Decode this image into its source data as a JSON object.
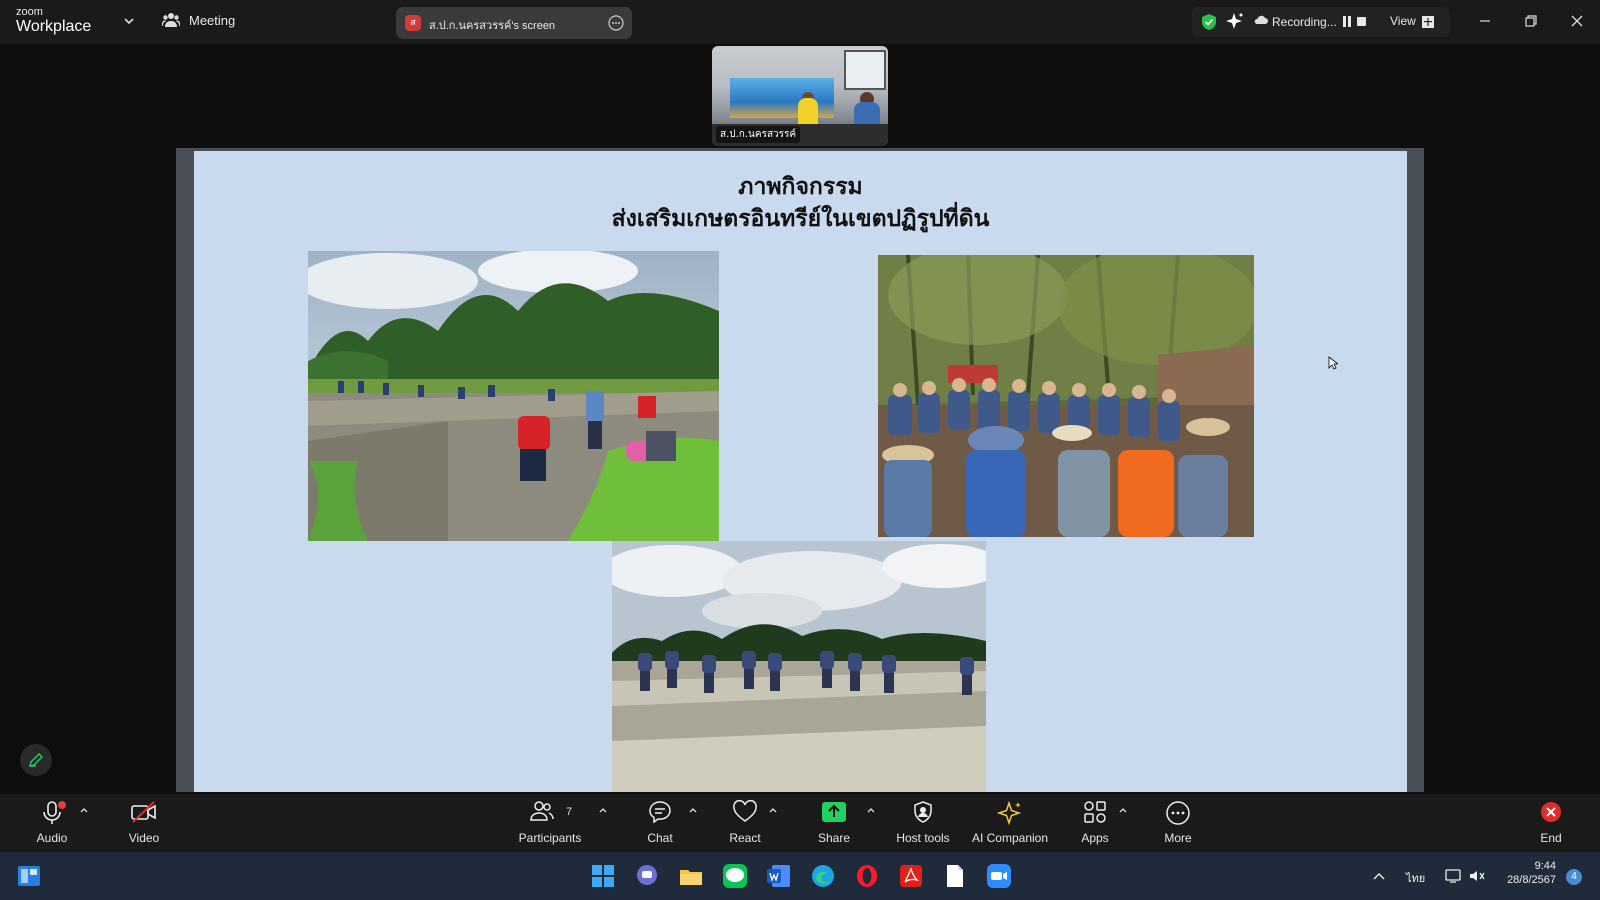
{
  "app": {
    "logo_top": "zoom",
    "logo_bottom": "Workplace"
  },
  "topbar": {
    "meeting_label": "Meeting",
    "screen_badge": "ส",
    "screen_title": "ส.ป.ก.นครสวรรค์'s screen",
    "recording_label": "Recording...",
    "view_label": "View"
  },
  "video": {
    "participant_name": "ส.ป.ก.นครสวรรค์"
  },
  "slide": {
    "title_line1": "ภาพกิจกรรม",
    "title_line2": "ส่งเสริมเกษตรอินทรีย์ในเขตปฏิรูปที่ดิน"
  },
  "toolbar": {
    "audio": "Audio",
    "video": "Video",
    "participants": "Participants",
    "participants_count": "7",
    "chat": "Chat",
    "react": "React",
    "share": "Share",
    "host_tools": "Host tools",
    "ai_companion": "AI Companion",
    "apps": "Apps",
    "more": "More",
    "end": "End"
  },
  "taskbar": {
    "language": "ไทย",
    "time": "9:44",
    "date": "28/8/2567",
    "notifications": "4"
  },
  "colors": {
    "accent_share": "#23d160",
    "end_red": "#e02b2b",
    "shield_green": "#27c24c",
    "slide_bg": "#c9daef"
  }
}
